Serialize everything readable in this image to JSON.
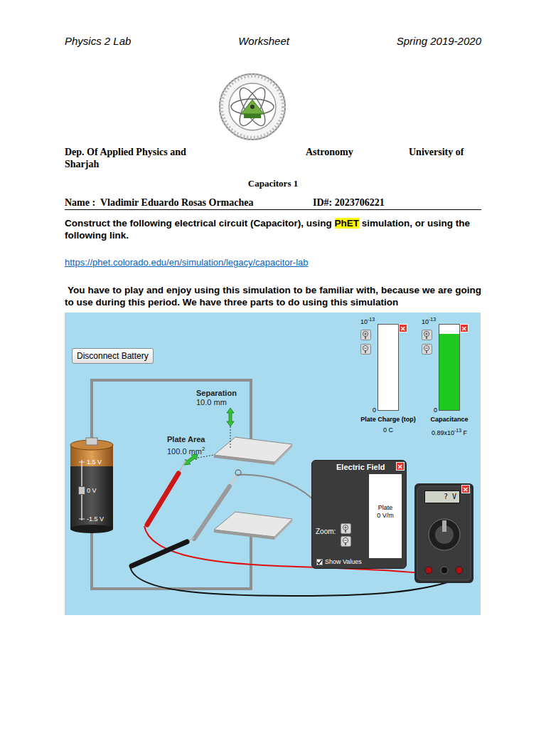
{
  "header": {
    "left": "Physics 2 Lab",
    "center": "Worksheet",
    "right": "Spring 2019-2020"
  },
  "affiliation": {
    "dept": "Dep. Of Applied Physics and",
    "dept2": "Astronomy",
    "univ": "University of",
    "univ2": "Sharjah"
  },
  "title": "Capacitors 1",
  "name_line": "Name :  Vladimir Eduardo Rosas Ormachea",
  "id_line": "ID#: 2023706221",
  "instructions": {
    "parts": [
      {
        "text": "Construct the following electrical circuit (Capacitor), using ",
        "highlighted": false
      },
      {
        "text": "PhET",
        "highlighted": true
      },
      {
        "text": " simulation, or using the following link.",
        "highlighted": false
      }
    ]
  },
  "link": "https://phet.colorado.edu/en/simulation/legacy/capacitor-lab",
  "paragraph": " You have to play and enjoy using this simulation to be familiar with, because we are going to use during this period. We have three parts to do using this simulation",
  "simulation": {
    "disconnect_button": "Disconnect Battery",
    "close_icon": "✕",
    "separation": {
      "label": "Separation",
      "value": "10.0 mm"
    },
    "plate_area": {
      "label": "Plate Area",
      "value": "100.0 mm",
      "value_sup": "2"
    },
    "battery": {
      "labels": [
        "1.5 V",
        "0 V",
        "-1.5 V"
      ],
      "level": 0.5
    },
    "meters": [
      {
        "label": "Plate Charge (top)",
        "base": "10",
        "exponent": "-13",
        "zero": "0",
        "value_parts": [
          {
            "text": "0 C",
            "sup": false
          }
        ],
        "level": 0,
        "color": "#e03030"
      },
      {
        "label": "Capacitance",
        "base": "10",
        "exponent": "-13",
        "zero": "0",
        "value_parts": [
          {
            "text": "0.89x10",
            "sup": false
          },
          {
            "text": "-13",
            "sup": true
          },
          {
            "text": " F",
            "sup": false
          }
        ],
        "level": 0.89,
        "color": "#1ec81e"
      }
    ],
    "electric_field": {
      "title": "Electric Field",
      "plate_label": "Plate",
      "plate_value": "0 V/m",
      "zoom_label": "Zoom:",
      "show_values": {
        "label": "Show Values",
        "checked": true
      }
    },
    "voltmeter": {
      "display": "? V"
    }
  }
}
